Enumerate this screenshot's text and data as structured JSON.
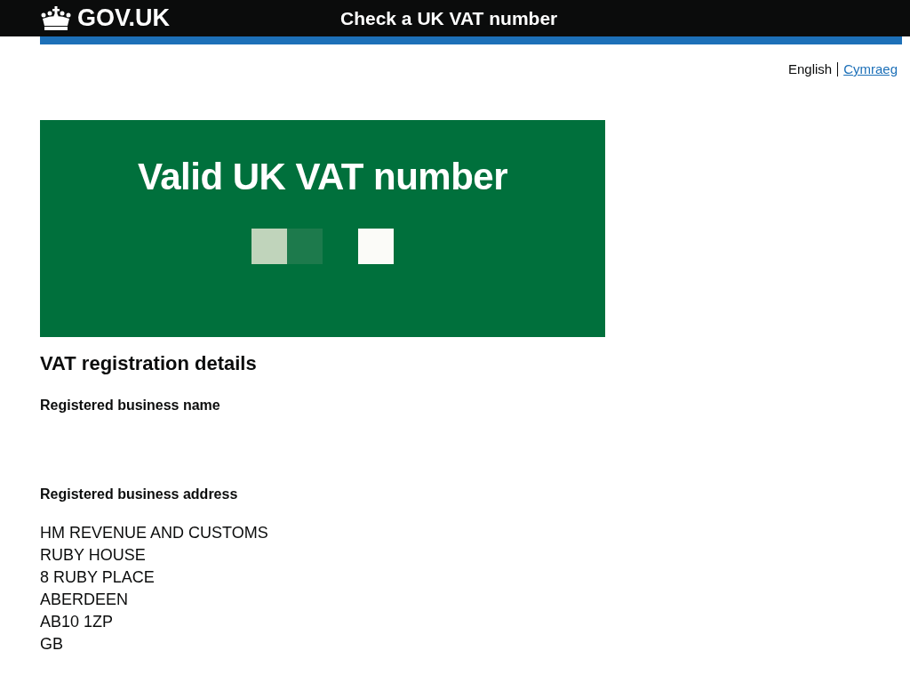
{
  "header": {
    "logo": "GOV.UK",
    "service_name": "Check a UK VAT number"
  },
  "languages": [
    {
      "label": "English",
      "selected": true
    },
    {
      "label": "Cymraeg",
      "selected": false
    }
  ],
  "panel": {
    "title": "Valid UK VAT number"
  },
  "details": {
    "heading": "VAT registration details",
    "name_label": "Registered business name",
    "address_label": "Registered business address",
    "address_lines": [
      "HM REVENUE AND CUSTOMS",
      "RUBY HOUSE",
      "8 RUBY PLACE",
      "ABERDEEN",
      "AB10 1ZP",
      "GB"
    ]
  }
}
